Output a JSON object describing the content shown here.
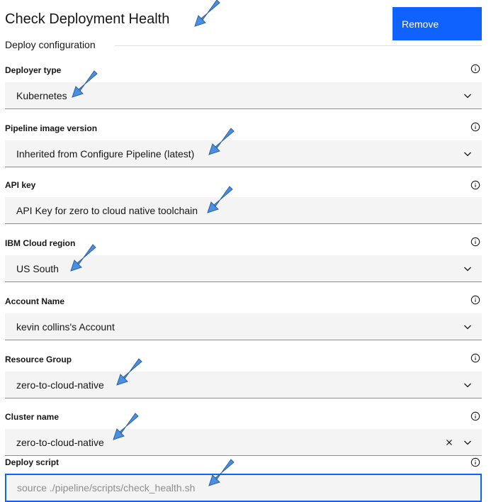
{
  "page": {
    "title": "Check Deployment Health",
    "remove_label": "Remove",
    "section_heading": "Deploy configuration"
  },
  "fields": [
    {
      "label": "Deployer type",
      "value": "Kubernetes",
      "control": "dropdown"
    },
    {
      "label": "Pipeline image version",
      "value": "Inherited from Configure Pipeline (latest)",
      "control": "dropdown"
    },
    {
      "label": "API key",
      "value": "API Key for zero to cloud native toolchain",
      "control": "text"
    },
    {
      "label": "IBM Cloud region",
      "value": "US South",
      "control": "dropdown"
    },
    {
      "label": "Account Name",
      "value": "kevin collins's Account",
      "control": "dropdown"
    },
    {
      "label": "Resource Group",
      "value": "zero-to-cloud-native",
      "control": "dropdown"
    },
    {
      "label": "Cluster name",
      "value": "zero-to-cloud-native",
      "control": "combobox"
    }
  ],
  "deploy_script": {
    "label": "Deploy script",
    "value": "source ./pipeline/scripts/check_health.sh"
  },
  "colors": {
    "accent": "#0f62fe",
    "field_bg": "#f4f4f4",
    "annotation_arrow": "#4a90e2"
  },
  "icons": {
    "info": "info-icon",
    "dropdown": "chevron-down-icon",
    "clear": "close-icon",
    "annotation": "arrow-icon"
  }
}
